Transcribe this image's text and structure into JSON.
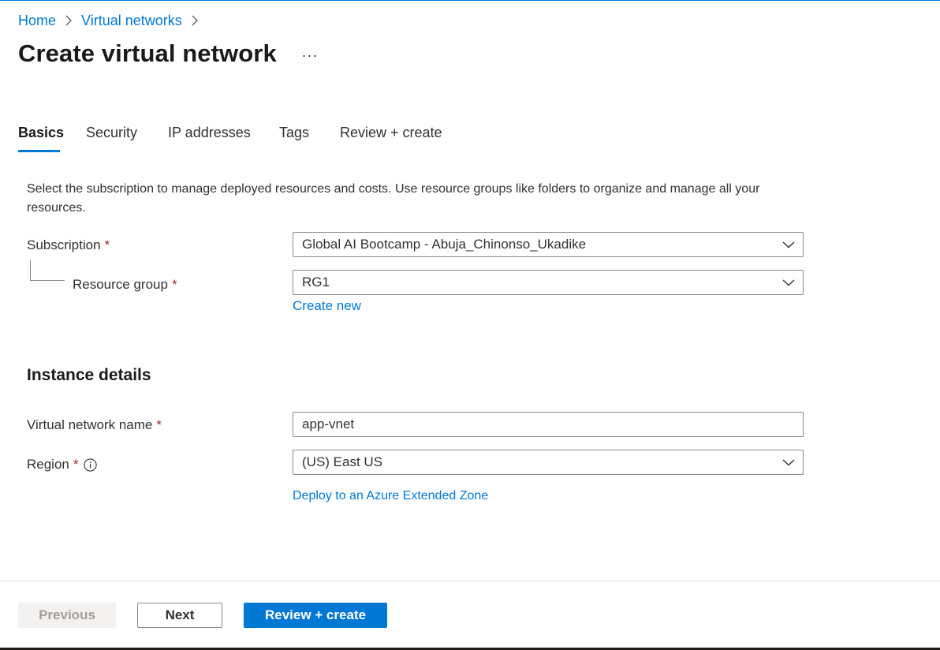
{
  "breadcrumb": {
    "items": [
      "Home",
      "Virtual networks"
    ]
  },
  "page": {
    "title": "Create virtual network",
    "more_label": "···"
  },
  "tabs": [
    {
      "label": "Basics",
      "active": true
    },
    {
      "label": "Security",
      "active": false
    },
    {
      "label": "IP addresses",
      "active": false
    },
    {
      "label": "Tags",
      "active": false
    },
    {
      "label": "Review + create",
      "active": false
    }
  ],
  "intro": {
    "text": "Select the subscription to manage deployed resources and costs. Use resource groups like folders to organize and manage all your resources."
  },
  "form": {
    "required_mark": "*",
    "subscription": {
      "label": "Subscription",
      "value": "Global AI Bootcamp - Abuja_Chinonso_Ukadike"
    },
    "resource_group": {
      "label": "Resource group",
      "value": "RG1",
      "create_new": "Create new"
    },
    "instance_details_title": "Instance details",
    "vnet_name": {
      "label": "Virtual network name",
      "value": "app-vnet"
    },
    "region": {
      "label": "Region",
      "value": "(US) East US",
      "extended_zone_link": "Deploy to an Azure Extended Zone"
    }
  },
  "footer": {
    "previous_label": "Previous",
    "next_label": "Next",
    "review_label": "Review + create"
  },
  "colors": {
    "accent": "#0078d4",
    "required": "#a4262c",
    "text": "#323130",
    "border": "#8a8886"
  },
  "icons": {
    "breadcrumb_separator": "chevron-right-icon",
    "dropdown": "chevron-down-icon",
    "info": "info-icon",
    "more": "more-horizontal-icon"
  }
}
